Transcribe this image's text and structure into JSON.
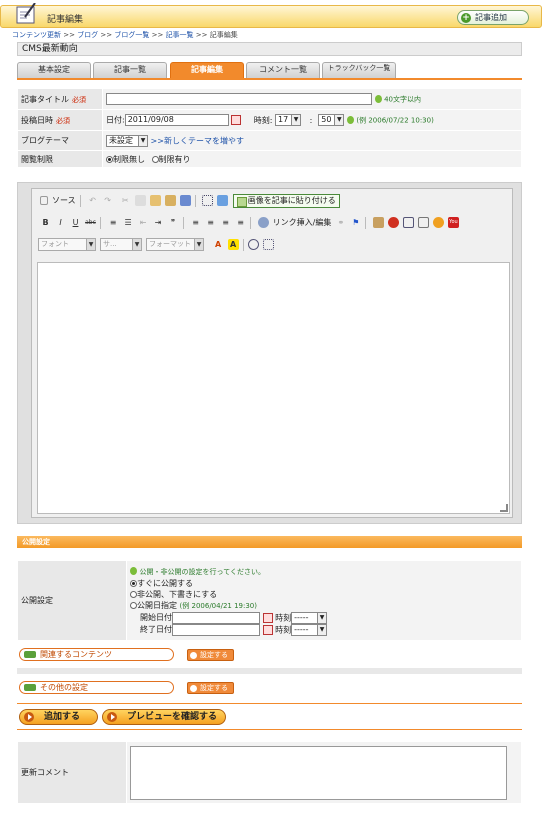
{
  "header": {
    "title": "記事編集",
    "add_button": "記事追加"
  },
  "breadcrumb": {
    "items": [
      "コンテンツ更新",
      "ブログ",
      "ブログ一覧",
      "記事一覧"
    ],
    "sep": " >> ",
    "current": "記事編集"
  },
  "section_title": "CMS最新動向",
  "tabs": [
    "基本設定",
    "記事一覧",
    "記事編集",
    "コメント一覧",
    "トラックバック一覧"
  ],
  "active_tab": "記事編集",
  "form": {
    "title_label": "記事タイトル",
    "required": "必須",
    "title_hint": "40文字以内",
    "date_label": "投稿日時",
    "date_prefix": "日付:",
    "date_value": "2011/09/08",
    "time_prefix": "時刻:",
    "hour": "17",
    "minute": "50",
    "colon": ":",
    "date_hint": "(例 2006/07/22 10:30)",
    "theme_label": "ブログテーマ",
    "theme_value": "未設定",
    "theme_link": ">>新しくテーマを増やす",
    "access_label": "閲覧制限",
    "access_opt1": "制限無し",
    "access_opt2": "制限有り"
  },
  "editor": {
    "source": "ソース",
    "paste_btn": "画像を記事に貼り付ける",
    "link_btn": "リンク挿入/編集",
    "font": "フォント",
    "size": "サ...",
    "format": "フォーマット",
    "bold": "B",
    "italic": "I",
    "underline": "U",
    "strike": "abc"
  },
  "publish": {
    "bar": "公開設定",
    "label": "公開設定",
    "hint": "公開・非公開の設定を行ってください。",
    "opt1": "すぐに公開する",
    "opt2": "非公開、下書きにする",
    "opt3": "公開日指定",
    "opt3_hint": "(例 2006/04/21 19:30)",
    "start": "開始日付",
    "end": "終了日付",
    "time": "時刻",
    "time_val": "-----"
  },
  "related": {
    "label": "関連するコンテンツ",
    "btn": "設定する"
  },
  "other": {
    "label": "その他の設定",
    "btn": "設定する"
  },
  "actions": {
    "add": "追加する",
    "preview": "プレビューを確認する"
  },
  "comment": {
    "label": "更新コメント"
  }
}
